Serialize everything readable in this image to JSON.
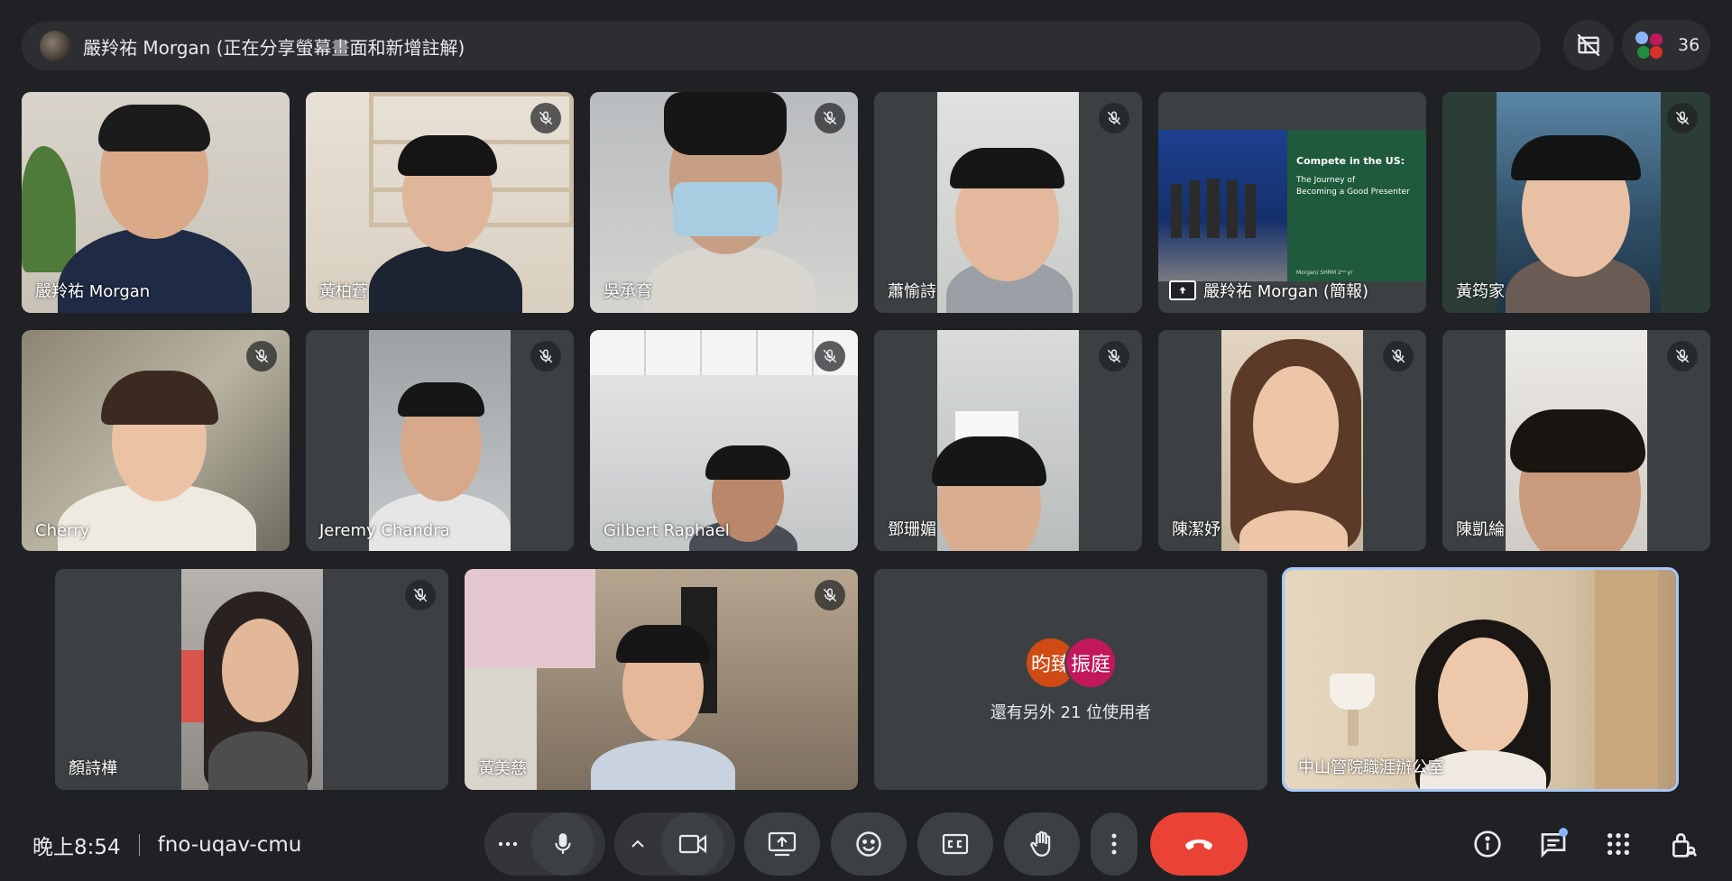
{
  "top_bar": {
    "presenter_label": "嚴羚祐 Morgan (正在分享螢幕畫面和新增註解)",
    "participant_count": "36"
  },
  "tiles": [
    {
      "name": "嚴羚祐 Morgan",
      "muted": false
    },
    {
      "name": "黃柏蒼",
      "muted": true
    },
    {
      "name": "吳承育",
      "muted": true
    },
    {
      "name": "蕭愉詩",
      "muted": true
    },
    {
      "name": "嚴羚祐 Morgan (簡報)",
      "muted": false
    },
    {
      "name": "黃筠家",
      "muted": true
    },
    {
      "name": "Cherry",
      "muted": true
    },
    {
      "name": "Jeremy Chandra",
      "muted": true
    },
    {
      "name": "Gilbert Raphael",
      "muted": true
    },
    {
      "name": "鄧珊媚",
      "muted": true
    },
    {
      "name": "陳潔妤",
      "muted": true
    },
    {
      "name": "陳凱綸",
      "muted": true
    },
    {
      "name": "顏詩樺",
      "muted": true
    },
    {
      "name": "黃美慈",
      "muted": true
    },
    {
      "name": "中山管院職涯辦公室",
      "muted": false
    }
  ],
  "presentation_slide": {
    "title": "Compete in the US:",
    "subtitle_line1": "The Journey of",
    "subtitle_line2": "Becoming a Good Presenter",
    "footer": "Morgan/ SHRM 2ⁿᵈ yr"
  },
  "others": {
    "avatar1": "昀臻",
    "avatar2": "振庭",
    "label": "還有另外 21 位使用者",
    "avatar1_color": "#d04a14",
    "avatar2_color": "#c2185b"
  },
  "bottom_bar": {
    "time": "晚上8:54",
    "meeting_code": "fno-uqav-cmu"
  },
  "colors": {
    "background": "#202124",
    "tile": "#3c4043",
    "end_call": "#ea4335",
    "active_speaker_border": "#8ab4f8"
  },
  "icons": [
    "user-avatar-icon",
    "hide-tiles-icon",
    "more-options-icon",
    "microphone-icon",
    "chevron-up-icon",
    "camera-icon",
    "present-screen-icon",
    "emoji-icon",
    "captions-icon",
    "raise-hand-icon",
    "more-vert-icon",
    "end-call-icon",
    "info-icon",
    "chat-icon",
    "activities-icon",
    "host-controls-icon",
    "mic-off-icon"
  ]
}
